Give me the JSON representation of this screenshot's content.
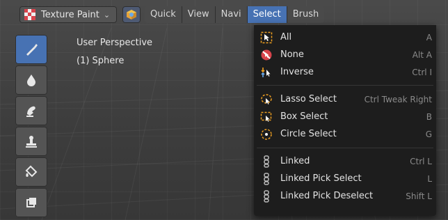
{
  "header": {
    "mode_label": "Texture Paint",
    "tabs": [
      "Quick",
      "View",
      "Navi",
      "Select",
      "Brush"
    ],
    "active_tab": "Select"
  },
  "viewport": {
    "perspective": "User Perspective",
    "object": "(1) Sphere"
  },
  "toolbar": {
    "tools": [
      "draw-brush-icon",
      "soften-icon",
      "smear-icon",
      "clone-icon",
      "fill-icon",
      "mask-icon"
    ]
  },
  "menu": {
    "items": [
      {
        "label": "All",
        "shortcut": "A",
        "icon": "select-all-icon"
      },
      {
        "label": "None",
        "shortcut": "Alt A",
        "icon": "select-none-icon"
      },
      {
        "label": "Inverse",
        "shortcut": "Ctrl I",
        "icon": "select-inverse-icon"
      },
      {
        "label": "Lasso Select",
        "shortcut": "Ctrl Tweak Right",
        "icon": "lasso-select-icon"
      },
      {
        "label": "Box Select",
        "shortcut": "B",
        "icon": "box-select-icon"
      },
      {
        "label": "Circle Select",
        "shortcut": "G",
        "icon": "circle-select-icon"
      },
      {
        "label": "Linked",
        "shortcut": "Ctrl L",
        "icon": "linked-icon"
      },
      {
        "label": "Linked Pick Select",
        "shortcut": "L",
        "icon": "linked-pick-select-icon"
      },
      {
        "label": "Linked Pick Deselect",
        "shortcut": "Shift L",
        "icon": "linked-pick-deselect-icon"
      }
    ]
  },
  "colors": {
    "accent": "#4772b3",
    "menu_bg": "#1d1d1d",
    "button_bg": "#545454"
  }
}
